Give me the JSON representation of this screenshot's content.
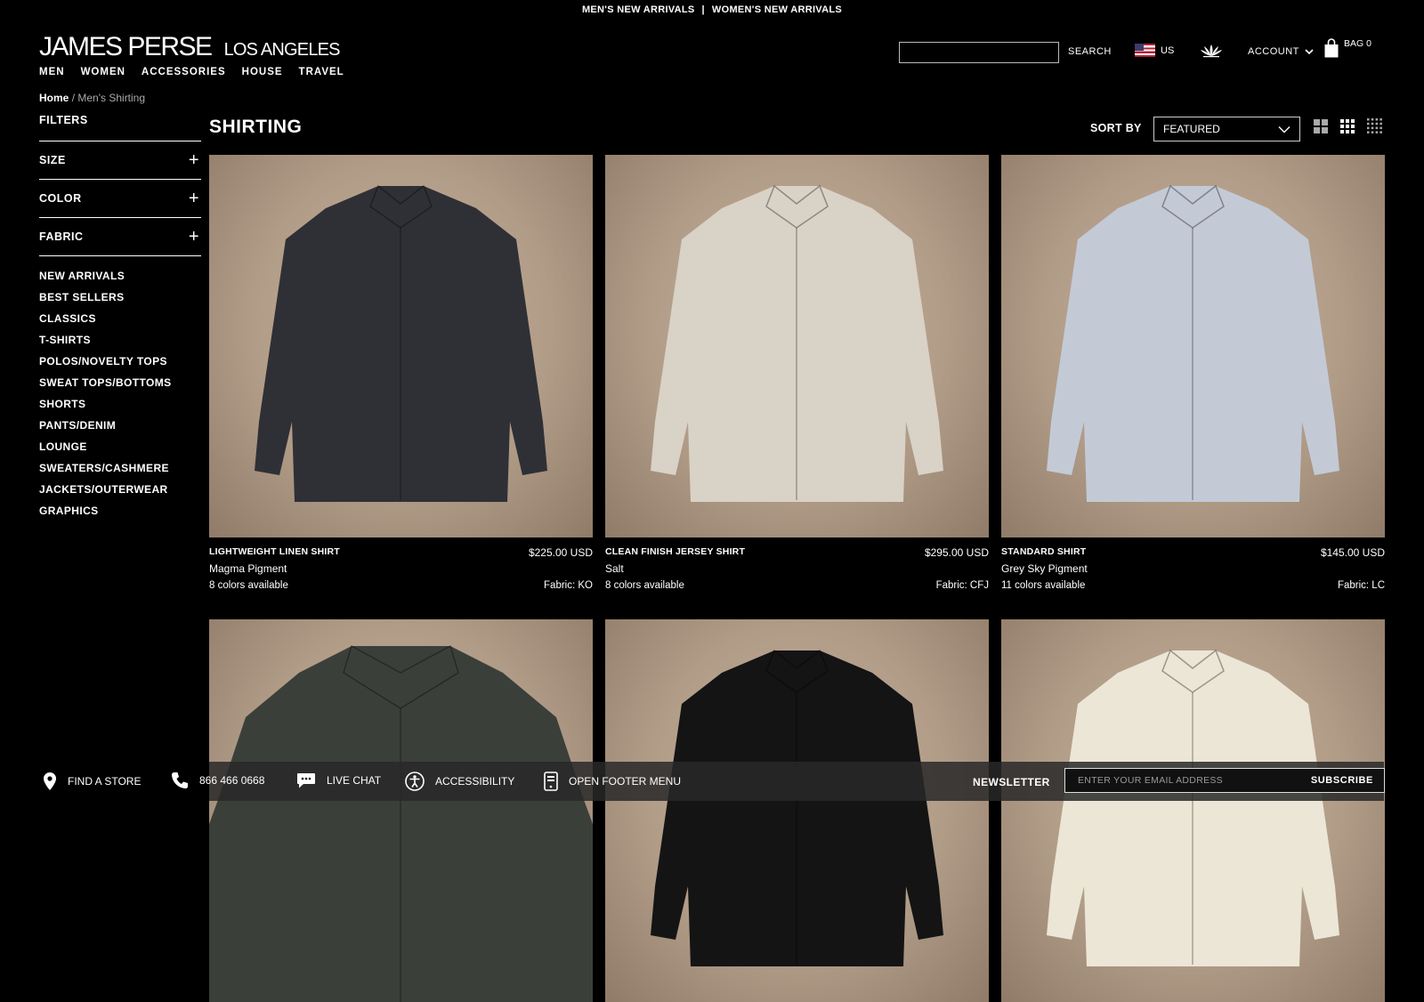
{
  "promo": {
    "mens": "MEN'S NEW ARRIVALS",
    "separator": "|",
    "womens": "WOMEN'S NEW ARRIVALS"
  },
  "header": {
    "brand": "JAMES PERSE",
    "city": "LOS ANGELES",
    "nav": [
      "MEN",
      "WOMEN",
      "ACCESSORIES",
      "HOUSE",
      "TRAVEL"
    ],
    "search_value": "",
    "search_label": "SEARCH",
    "locale": "US",
    "account": "ACCOUNT",
    "bag": "BAG 0"
  },
  "breadcrumb": {
    "home": "Home",
    "separator": "/",
    "current": "Men's Shirting"
  },
  "sidebar": {
    "filters_title": "FILTERS",
    "facets": [
      "SIZE",
      "COLOR",
      "FABRIC"
    ],
    "categories": [
      "NEW ARRIVALS",
      "BEST SELLERS",
      "CLASSICS",
      "T-SHIRTS",
      "POLOS/NOVELTY TOPS",
      "SWEAT TOPS/BOTTOMS",
      "SHORTS",
      "PANTS/DENIM",
      "LOUNGE",
      "SWEATERS/CASHMERE",
      "JACKETS/OUTERWEAR",
      "GRAPHICS"
    ]
  },
  "main": {
    "title": "SHIRTING",
    "sort_label": "SORT BY",
    "sort_value": "FEATURED"
  },
  "products": [
    {
      "name": "LIGHTWEIGHT LINEN SHIRT",
      "price": "$225.00 USD",
      "color": "Magma Pigment",
      "colors_available": "8 colors available",
      "fabric": "Fabric: KO",
      "swatch": "#2f3035"
    },
    {
      "name": "CLEAN FINISH JERSEY SHIRT",
      "price": "$295.00 USD",
      "color": "Salt",
      "colors_available": "8 colors available",
      "fabric": "Fabric: CFJ",
      "swatch": "#d9d2c6"
    },
    {
      "name": "STANDARD SHIRT",
      "price": "$145.00 USD",
      "color": "Grey Sky Pigment",
      "colors_available": "11 colors available",
      "fabric": "Fabric: LC",
      "swatch": "#c3cad6"
    },
    {
      "swatch": "#3b3f3a"
    },
    {
      "swatch": "#141414"
    },
    {
      "swatch": "#ece6d6"
    }
  ],
  "footer": {
    "find_store": "FIND A STORE",
    "phone": "866 466 0668",
    "live_chat": "LIVE CHAT",
    "accessibility": "ACCESSIBILITY",
    "open_footer": "OPEN FOOTER MENU",
    "newsletter": "NEWSLETTER",
    "email_placeholder": "ENTER YOUR EMAIL ADDRESS",
    "subscribe": "SUBSCRIBE"
  }
}
